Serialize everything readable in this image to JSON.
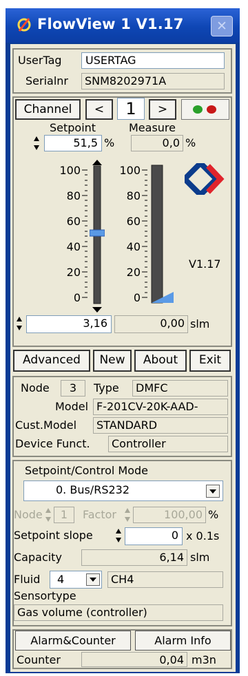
{
  "title": "FlowView 1 V1.17",
  "close_glyph": "✕",
  "usertag": {
    "label": "UserTag",
    "value": "USERTAG"
  },
  "serial": {
    "label": "Serialnr",
    "value": "SNM8202971A"
  },
  "channel": {
    "button": "Channel",
    "prev": "<",
    "value": "1",
    "next": ">"
  },
  "setpoint": {
    "label": "Setpoint",
    "value": "51,5",
    "unit": "%"
  },
  "measure": {
    "label": "Measure",
    "value": "0,0",
    "unit": "%"
  },
  "scale_ticks": [
    "100",
    "80",
    "60",
    "40",
    "20",
    "0"
  ],
  "scale_ticks_right": [
    "100",
    "80",
    "60",
    "40",
    "20",
    "0"
  ],
  "slider": {
    "setpoint_fraction": 0.515,
    "measure_fraction": 0.0
  },
  "version": "V1.17",
  "flow": {
    "setpoint": "3,16",
    "measure": "0,00",
    "unit": "slm"
  },
  "buttons": {
    "advanced": "Advanced",
    "new": "New",
    "about": "About",
    "exit": "Exit"
  },
  "node_info": {
    "node_label": "Node",
    "node_value": "3",
    "type_label": "Type",
    "type_value": "DMFC",
    "model_label": "Model",
    "model_value": "F-201CV-20K-AAD-",
    "cust_label": "Cust.Model",
    "cust_value": "STANDARD",
    "funct_label": "Device Funct.",
    "funct_value": "Controller"
  },
  "control": {
    "mode_label": "Setpoint/Control Mode",
    "mode_value": "0. Bus/RS232",
    "node_label": "Node",
    "node_value": "1",
    "factor_label": "Factor",
    "factor_value": "100,00",
    "factor_unit": "%",
    "slope_label": "Setpoint slope",
    "slope_value": "0",
    "slope_unit": "x 0.1s",
    "capacity_label": "Capacity",
    "capacity_value": "6,14",
    "capacity_unit": "slm",
    "fluid_label": "Fluid",
    "fluid_value": "4",
    "fluid_name": "CH4",
    "sensortype_label": "Sensortype",
    "sensortype_value": "Gas volume (controller)"
  },
  "alarm": {
    "counter_button": "Alarm&Counter",
    "info_button": "Alarm Info",
    "counter_label": "Counter",
    "counter_value": "0,04",
    "counter_unit": "m3n"
  },
  "colors": {
    "title_bar": "#0e46b4",
    "logo_blue": "#0b3c8c",
    "logo_red": "#e0242c",
    "led_green": "#2aa02a",
    "led_red": "#c81818",
    "slider_thumb": "#5a9ae6"
  }
}
